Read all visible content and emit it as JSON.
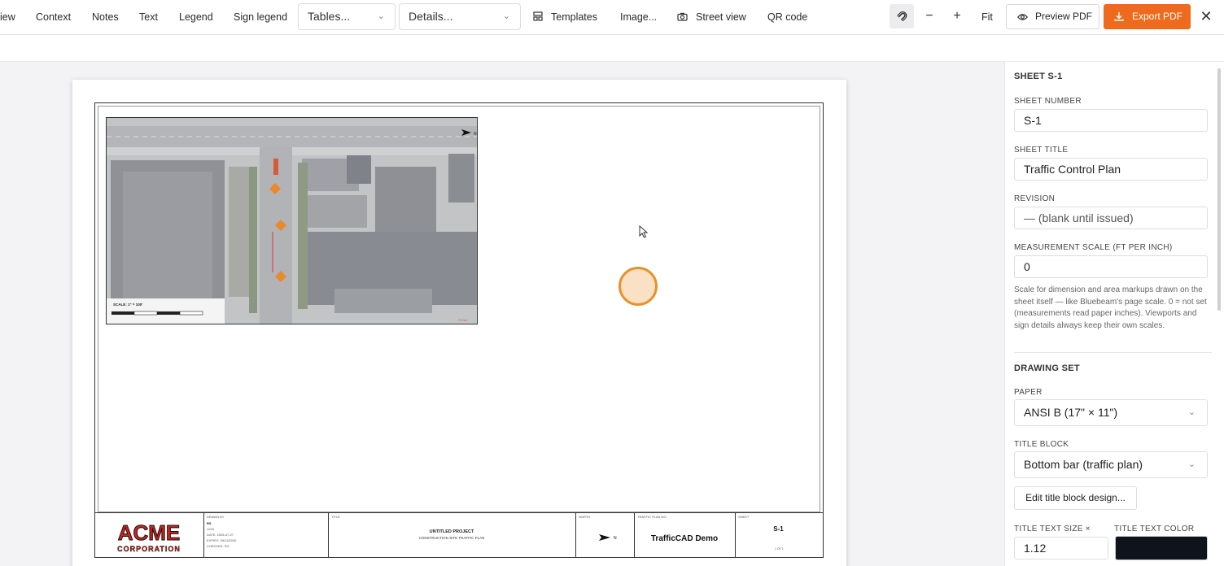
{
  "toolbar": {
    "items": [
      "iew",
      "Context",
      "Notes",
      "Text",
      "Legend",
      "Sign legend"
    ],
    "tables_select": "Tables...",
    "details_select": "Details...",
    "templates": "Templates",
    "image": "Image...",
    "street_view": "Street view",
    "qr_code": "QR code",
    "fit": "Fit",
    "preview_pdf": "Preview PDF",
    "export_pdf": "Export PDF",
    "accent_color": "#ee6a1c"
  },
  "sheet": {
    "viewport_scale_label": "SCALE: 1\" = 100'",
    "title_block": {
      "company_top": "ACME",
      "company_bottom": "CORPORATION",
      "drawn_by_label": "DRAWN BY",
      "drawn_by": "RS",
      "job": "1234",
      "date": "DATE: 2026-07-27",
      "expiry": "EXPIRY: 09/11/2030",
      "checked": "CHECKED: SG",
      "title_label": "TITLE",
      "project_title": "UNTITLED PROJECT",
      "project_subtitle": "CONSTRUCTION SITE TRAFFIC PLAN",
      "north_label": "NORTH",
      "north_letter": "N",
      "plan_label": "TRAFFIC PLAN NO.",
      "plan_name": "TrafficCAD Demo",
      "sheet_label": "SHEET",
      "sheet_number": "S-1",
      "sheet_of": "1 OF 1"
    }
  },
  "panel": {
    "heading": "SHEET S-1",
    "sheet_number_label": "SHEET NUMBER",
    "sheet_number_value": "S-1",
    "sheet_title_label": "SHEET TITLE",
    "sheet_title_value": "Traffic Control Plan",
    "revision_label": "REVISION",
    "revision_placeholder": "— (blank until issued)",
    "scale_label": "MEASUREMENT SCALE (FT PER INCH)",
    "scale_value": "0",
    "scale_note": "Scale for dimension and area markups drawn on the sheet itself — like Bluebeam's page scale. 0 = not set (measurements read paper inches). Viewports and sign details always keep their own scales.",
    "drawing_set_heading": "DRAWING SET",
    "paper_label": "PAPER",
    "paper_value": "ANSI B (17\" × 11\")",
    "title_block_label": "TITLE BLOCK",
    "title_block_value": "Bottom bar (traffic plan)",
    "edit_button": "Edit title block design...",
    "title_text_size_label": "TITLE TEXT SIZE ×",
    "title_text_size_value": "1.12",
    "title_text_color_label": "TITLE TEXT COLOR",
    "title_text_color": "#0e131c"
  }
}
